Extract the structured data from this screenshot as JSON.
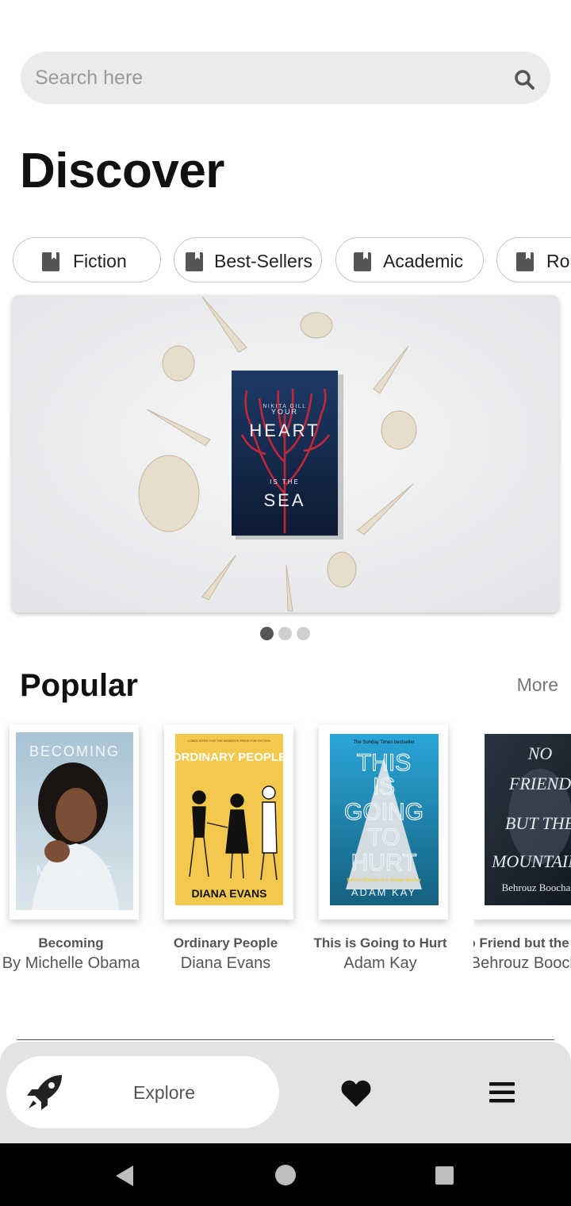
{
  "search": {
    "placeholder": "Search here"
  },
  "page_title": "Discover",
  "categories": [
    {
      "label": "Fiction",
      "icon": "book-icon"
    },
    {
      "label": "Best-Sellers",
      "icon": "book-icon"
    },
    {
      "label": "Academic",
      "icon": "book-icon"
    },
    {
      "label": "Romance",
      "icon": "book-icon"
    }
  ],
  "carousel": {
    "featured_cover": {
      "author": "NIKITA GILL",
      "line1": "YOUR",
      "line2": "HEART",
      "line3": "IS THE",
      "line4": "SEA"
    },
    "slide_count": 3,
    "active_slide": 1
  },
  "popular": {
    "title": "Popular",
    "more_label": "More",
    "books": [
      {
        "title": "Becoming",
        "author": "By Michelle Obama",
        "cover_top": "BECOMING",
        "cover_bottom1": "MICHELLE",
        "cover_bottom2": "OBAMA"
      },
      {
        "title": "Ordinary People",
        "author": "Diana Evans",
        "cover_top": "ORDINARY PEOPLE",
        "cover_bottom": "DIANA EVANS",
        "cover_prize": "LONGLISTED FOR THE WOMEN'S PRIZE FOR FICTION"
      },
      {
        "title": "This is Going to Hurt",
        "author": "Adam Kay",
        "cover_banner": "The Sunday Times bestseller",
        "cover_lines": [
          "THIS",
          "IS",
          "GOING",
          "TO",
          "HURT"
        ],
        "cover_sub": "Secret Diaries of a Junior Doctor",
        "cover_author": "ADAM KAY"
      },
      {
        "title": "No Friend but the Mountains",
        "author": "Behrouz Boochani",
        "cover_lines": [
          "NO",
          "FRIEND",
          "BUT THE",
          "MOUNTAINS"
        ],
        "cover_author": "Behrouz Boochani"
      }
    ]
  },
  "bottom_nav": {
    "explore_label": "Explore",
    "items": [
      "rocket-icon",
      "heart-icon",
      "menu-icon"
    ]
  },
  "colors": {
    "search_bg": "#ebebeb",
    "nav_bg": "#e3e3e3",
    "dot_active": "#555555",
    "dot_inactive": "#cfcfcf",
    "text_dark": "#111111",
    "text_muted": "#757575"
  }
}
